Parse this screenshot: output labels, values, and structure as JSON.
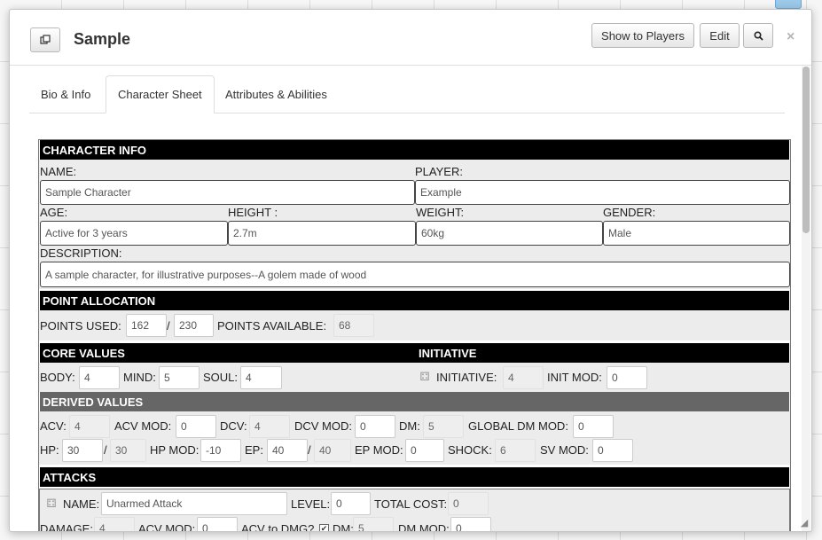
{
  "dialog": {
    "title": "Sample",
    "show_to_players": "Show to Players",
    "edit": "Edit",
    "popout_icon": "popout-icon",
    "search_icon": "search-icon",
    "close_icon": "close-icon"
  },
  "tabs": [
    "Bio & Info",
    "Character Sheet",
    "Attributes & Abilities"
  ],
  "character_info": {
    "header": "CHARACTER INFO",
    "name_label": "NAME:",
    "name": "Sample Character",
    "player_label": "PLAYER:",
    "player": "Example",
    "age_label": "AGE:",
    "age": "Active for 3 years",
    "height_label": "HEIGHT :",
    "height": "2.7m",
    "weight_label": "WEIGHT:",
    "weight": "60kg",
    "gender_label": "GENDER:",
    "gender": "Male",
    "description_label": "DESCRIPTION:",
    "description": "A sample character, for illustrative purposes--A golem made of wood"
  },
  "points": {
    "header": "POINT ALLOCATION",
    "used_label": "POINTS USED:",
    "used": "162",
    "slash": "/",
    "total": "230",
    "available_label": "POINTS AVAILABLE:",
    "available": "68"
  },
  "core": {
    "header": "CORE VALUES",
    "body_label": "BODY:",
    "body": "4",
    "mind_label": "MIND:",
    "mind": "5",
    "soul_label": "SOUL:",
    "soul": "4"
  },
  "initiative": {
    "header": "INITIATIVE",
    "label": "INITIATIVE:",
    "value": "4",
    "mod_label": "INIT MOD:",
    "mod": "0"
  },
  "derived": {
    "header": "DERIVED VALUES",
    "acv_label": "ACV:",
    "acv": "4",
    "acv_mod_label": "ACV MOD:",
    "acv_mod": "0",
    "dcv_label": "DCV:",
    "dcv": "4",
    "dcv_mod_label": "DCV MOD:",
    "dcv_mod": "0",
    "dm_label": "DM:",
    "dm": "5",
    "global_dm_label": "GLOBAL DM MOD:",
    "global_dm": "0",
    "hp_label": "HP:",
    "hp": "30",
    "slash": "/",
    "hp_max": "30",
    "hp_mod_label": "HP MOD:",
    "hp_mod": "-10",
    "ep_label": "EP:",
    "ep": "40",
    "ep_max": "40",
    "ep_mod_label": "EP MOD:",
    "ep_mod": "0",
    "shock_label": "SHOCK:",
    "shock": "6",
    "sv_mod_label": "SV MOD:",
    "sv_mod": "0"
  },
  "attacks": {
    "header": "ATTACKS",
    "name_label": "NAME:",
    "name": "Unarmed Attack",
    "level_label": "LEVEL:",
    "level": "0",
    "total_cost_label": "TOTAL COST:",
    "total_cost": "0",
    "damage_label": "DAMAGE:",
    "damage": "4",
    "acv_mod_label": "ACV MOD:",
    "acv_mod": "0",
    "acv_to_dmg_label": "ACV to DMG?",
    "acv_to_dmg_checked": true,
    "dm_label": "DM:",
    "dm": "5",
    "dm_mod_label": "DM MOD:",
    "dm_mod": "0"
  }
}
